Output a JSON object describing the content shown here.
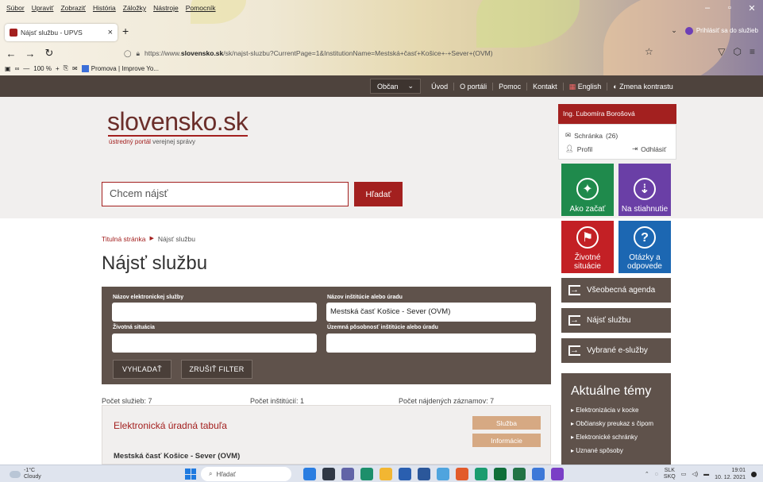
{
  "browser": {
    "menu": [
      "Súbor",
      "Upraviť",
      "Zobraziť",
      "História",
      "Záložky",
      "Nástroje",
      "Pomocník"
    ],
    "tab_title": "Nájsť službu - UPVS",
    "tab_close": "×",
    "new_tab": "+",
    "url_prefix": "https://www.",
    "url_domain": "slovensko.sk",
    "url_rest": "/sk/najst-sluzbu?CurrentPage=1&InstitutionName=Mestská+časť+Košice+-+Sever+(OVM)",
    "account": "Prihlásiť sa do služieb",
    "zoom": "100 %",
    "bookmark": "Promova | Improve Yo..."
  },
  "topbar": {
    "select_label": "Občan",
    "links": [
      "Úvod",
      "O portáli",
      "Pomoc",
      "Kontakt"
    ],
    "language": "English",
    "contrast": "Zmena kontrastu"
  },
  "header": {
    "logo": "slovensko.sk",
    "logo_sub_a": "ústredný portál",
    "logo_sub_b": "verejnej správy",
    "search_placeholder": "Chcem nájsť",
    "search_button": "Hľadať"
  },
  "user": {
    "name": "Ing. Ľubomíra Borošová",
    "inbox_label": "Schránka",
    "inbox_count": "(26)",
    "profile": "Profil",
    "logout": "Odhlásiť"
  },
  "tiles": [
    {
      "label": "Ako začať",
      "color": "#1f8a4c"
    },
    {
      "label": "Na stiahnutie",
      "color": "#6a3fa6"
    },
    {
      "label": "Životné situácie",
      "color": "#c32025"
    },
    {
      "label": "Otázky a odpovede",
      "color": "#1c67b2"
    }
  ],
  "side_buttons": [
    "Všeobecná agenda",
    "Nájsť službu",
    "Vybrané e-služby"
  ],
  "topics": {
    "title": "Aktuálne témy",
    "items": [
      "Elektronizácia v kocke",
      "Občiansky preukaz s čipom",
      "Elektronické schránky",
      "Uznané spôsoby"
    ]
  },
  "breadcrumb": {
    "home": "Titulná stránka",
    "current": "Nájsť službu"
  },
  "page_title": "Nájsť službu",
  "filter": {
    "service_name_label": "Názov elektronickej služby",
    "service_name_value": "",
    "institution_label": "Názov inštitúcie alebo úradu",
    "institution_value": "Mestská časť Košice - Sever (OVM)",
    "life_situation_label": "Životná situácia",
    "life_situation_value": "",
    "territory_label": "Územná pôsobnosť inštitúcie alebo úradu",
    "territory_value": "",
    "search_button": "VYHĽADAŤ",
    "reset_button": "ZRUŠIŤ FILTER"
  },
  "counts": {
    "services": "Počet služieb: 7",
    "institutions": "Počet inštitúcií: 1",
    "records": "Počet nájdených záznamov: 7"
  },
  "result": {
    "title": "Elektronická úradná tabuľa",
    "badge_service": "Služba",
    "badge_info": "Informácie",
    "org": "Mestská časť Košice - Sever (OVM)"
  },
  "taskbar": {
    "temp": "-1°C",
    "weather": "Cloudy",
    "search": "Hľadať",
    "lang_a": "SLK",
    "lang_b": "SKQ",
    "time": "19:01",
    "date": "10. 12. 2021"
  }
}
